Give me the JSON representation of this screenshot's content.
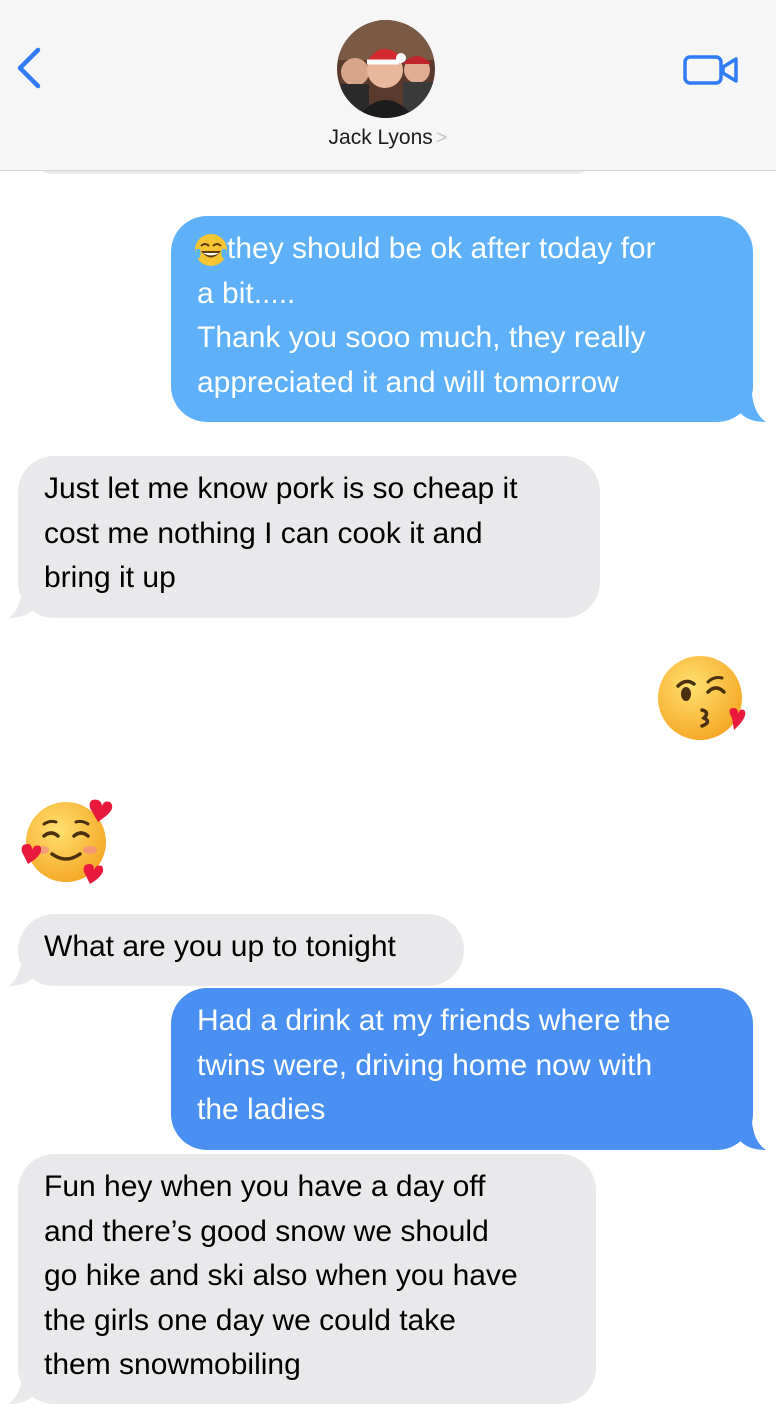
{
  "header": {
    "contact_name": "Jack Lyons",
    "chevron": ">",
    "back_icon": "chevron-left-icon",
    "video_icon": "video-camera-icon",
    "accent": "#2f7cf6"
  },
  "messages": [
    {
      "direction": "sent",
      "emoji_prefix": "tears-of-joy-emoji",
      "text_line1": "they should be ok after today for",
      "text_rest": [
        "a bit.....",
        "Thank you sooo much, they really",
        "appreciated it and will tomorrow"
      ]
    },
    {
      "direction": "received",
      "lines": [
        "Just let me know pork is so cheap it",
        "cost me nothing I can cook it and",
        "bring it up"
      ]
    },
    {
      "direction": "sent",
      "emoji": "face-blowing-a-kiss-emoji"
    },
    {
      "direction": "received",
      "emoji": "smiling-face-with-hearts-emoji"
    },
    {
      "direction": "received",
      "lines": [
        "What are you up to tonight"
      ]
    },
    {
      "direction": "sent",
      "lines": [
        "Had a drink at my friends where the",
        "twins were, driving home now with",
        "the ladies"
      ]
    },
    {
      "direction": "received",
      "lines": [
        "Fun hey when you have a day off",
        "and there’s good snow we should",
        "go hike and ski also when you have",
        "the girls one day we could take",
        "them snowmobiling"
      ]
    }
  ],
  "colors": {
    "sent_light": "#5eb0f9",
    "sent_blue": "#4a90f2",
    "received": "#e9e9eb"
  }
}
